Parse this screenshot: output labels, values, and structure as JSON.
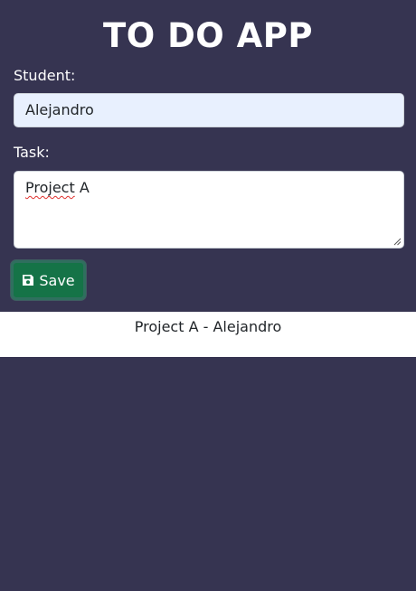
{
  "app": {
    "title": "TO DO APP",
    "background_color": "#363451"
  },
  "form": {
    "student_label": "Student:",
    "student_value": "Alejandro",
    "task_label": "Task:",
    "task_value_first": "Project",
    "task_value_rest": " A",
    "save_label": "Save",
    "save_icon": "floppy-disk-icon",
    "save_color": "#157347"
  },
  "tasks": [
    {
      "text": "Project A - Alejandro"
    }
  ]
}
